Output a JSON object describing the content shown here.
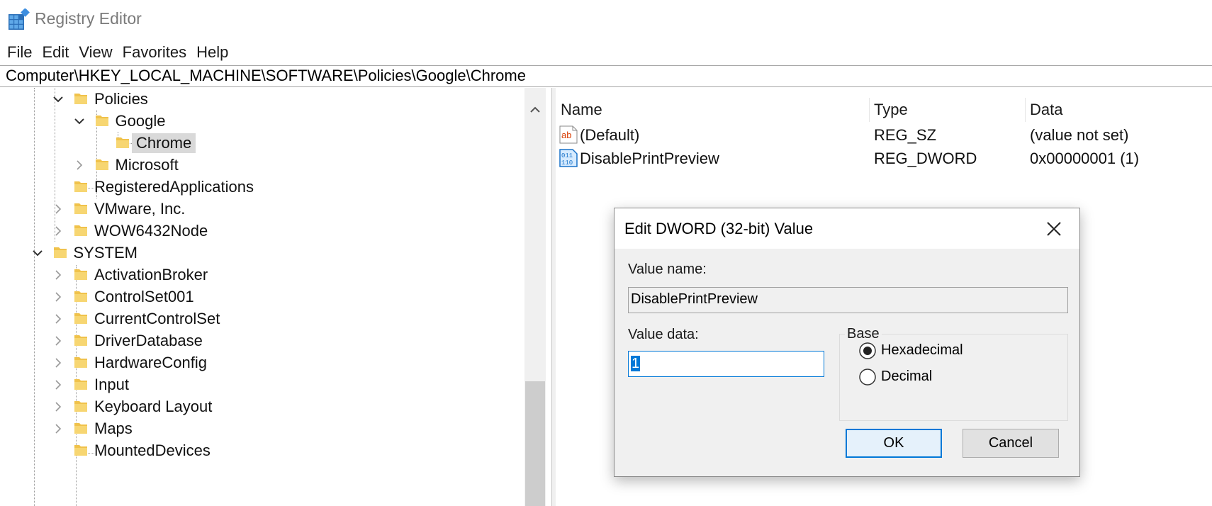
{
  "window": {
    "title": "Registry Editor"
  },
  "menu": [
    "File",
    "Edit",
    "View",
    "Favorites",
    "Help"
  ],
  "address": "Computer\\HKEY_LOCAL_MACHINE\\SOFTWARE\\Policies\\Google\\Chrome",
  "tree": {
    "items": [
      {
        "label": "Policies",
        "expander": "expanded"
      },
      {
        "label": "Google",
        "expander": "expanded"
      },
      {
        "label": "Chrome",
        "expander": "none",
        "selected": true
      },
      {
        "label": "Microsoft",
        "expander": "collapsed"
      },
      {
        "label": "RegisteredApplications",
        "expander": "none"
      },
      {
        "label": "VMware, Inc.",
        "expander": "collapsed"
      },
      {
        "label": "WOW6432Node",
        "expander": "collapsed"
      },
      {
        "label": "SYSTEM",
        "expander": "expanded"
      },
      {
        "label": "ActivationBroker",
        "expander": "collapsed"
      },
      {
        "label": "ControlSet001",
        "expander": "collapsed"
      },
      {
        "label": "CurrentControlSet",
        "expander": "collapsed"
      },
      {
        "label": "DriverDatabase",
        "expander": "collapsed"
      },
      {
        "label": "HardwareConfig",
        "expander": "collapsed"
      },
      {
        "label": "Input",
        "expander": "collapsed"
      },
      {
        "label": "Keyboard Layout",
        "expander": "collapsed"
      },
      {
        "label": "Maps",
        "expander": "collapsed"
      },
      {
        "label": "MountedDevices",
        "expander": "none"
      }
    ]
  },
  "list": {
    "columns": [
      "Name",
      "Type",
      "Data"
    ],
    "rows": [
      {
        "name": "(Default)",
        "type": "REG_SZ",
        "data": "(value not set)",
        "icon": "string-value-icon",
        "icon_text": "ab"
      },
      {
        "name": "DisablePrintPreview",
        "type": "REG_DWORD",
        "data": "0x00000001 (1)",
        "icon": "binary-value-icon",
        "icon_text": [
          "011",
          "110"
        ]
      }
    ]
  },
  "dialog": {
    "title": "Edit DWORD (32-bit) Value",
    "value_name_label": "Value name:",
    "value_name": "DisablePrintPreview",
    "value_data_label": "Value data:",
    "value_data": "1",
    "base_label": "Base",
    "base_options": [
      {
        "label": "Hexadecimal",
        "checked": true
      },
      {
        "label": "Decimal",
        "checked": false
      }
    ],
    "ok_label": "OK",
    "cancel_label": "Cancel"
  },
  "colors": {
    "accent": "#0078d7",
    "folder": "#f0c24b",
    "string_icon_red": "#d83b01",
    "binary_icon_blue": "#1a73c8"
  }
}
